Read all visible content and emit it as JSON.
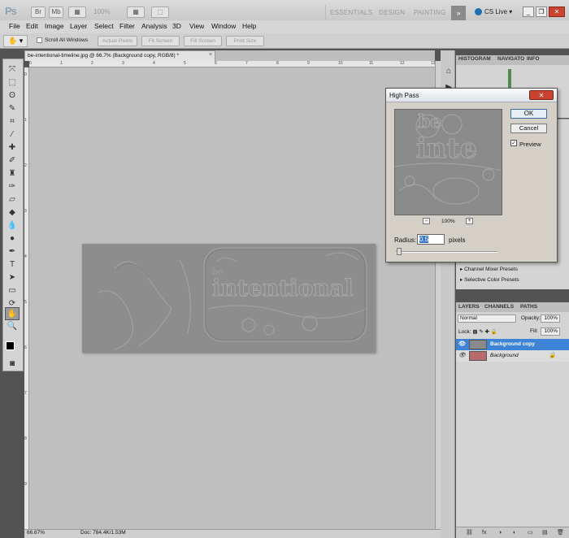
{
  "app": {
    "logo": "Ps",
    "zoom_select": "100%",
    "workspaces": [
      "ESSENTIALS",
      "DESIGN",
      "PAINTING"
    ],
    "more_label": "»",
    "cs_live": "CS Live"
  },
  "menu": [
    "File",
    "Edit",
    "Image",
    "Layer",
    "Select",
    "Filter",
    "Analysis",
    "3D",
    "View",
    "Window",
    "Help"
  ],
  "options": {
    "scroll_all": "Scroll All Windows",
    "buttons": [
      "Actual Pixels",
      "Fit Screen",
      "Fill Screen",
      "Print Size"
    ]
  },
  "document": {
    "tab_title": "be-intentional-timeline.jpg @ 66.7% (Background copy, RGB/8) *",
    "ruler_top": [
      "0",
      "1",
      "2",
      "3",
      "4",
      "5",
      "6",
      "7",
      "8",
      "9",
      "10",
      "11",
      "12",
      "13"
    ],
    "ruler_left": [
      "0",
      "1",
      "2",
      "3",
      "4",
      "5",
      "6",
      "7",
      "8",
      "9"
    ],
    "image_text": "intentional",
    "image_sub": "be"
  },
  "status": {
    "zoom": "66.67%",
    "doc": "Doc: 784.4K/1.53M"
  },
  "panels": {
    "top_tabs": [
      "HISTOGRAM",
      "NAVIGATO",
      "INFO"
    ],
    "adjust_items": [
      "Channel Mixer Presets",
      "Selective Color Presets"
    ],
    "layer_tabs": [
      "LAYERS",
      "CHANNELS",
      "PATHS"
    ],
    "blend_mode": "Normal",
    "opacity_label": "Opacity:",
    "opacity": "100%",
    "lock_label": "Lock:",
    "fill_label": "Fill:",
    "fill": "100%",
    "layers": [
      "Background copy",
      "Background"
    ],
    "footer_icons": "fx"
  },
  "dialog": {
    "title": "High Pass",
    "ok": "OK",
    "cancel": "Cancel",
    "preview_label": "Preview",
    "zoom": "100%",
    "radius_label": "Radius:",
    "radius_value": "0.5",
    "radius_unit": "pixels",
    "preview_text_1": "be",
    "preview_text_2": "inte"
  },
  "colors": {
    "selected_layer": "#3d84d6",
    "close_button": "#c9432e",
    "histogram": "#4f8d4f"
  }
}
